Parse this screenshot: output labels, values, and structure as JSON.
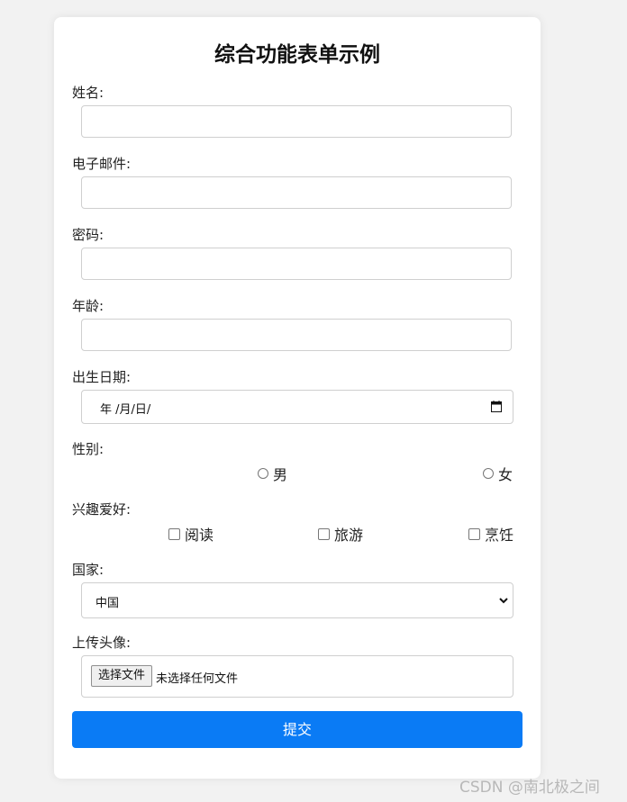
{
  "form": {
    "title": "综合功能表单示例",
    "name_label": "姓名:",
    "email_label": "电子邮件:",
    "password_label": "密码:",
    "age_label": "年龄:",
    "birthdate_label": "出生日期:",
    "birthdate_placeholder": "年 /月/日/",
    "gender_label": "性别:",
    "gender_options": [
      "男",
      "女"
    ],
    "hobbies_label": "兴趣爱好:",
    "hobby_options": [
      "阅读",
      "旅游",
      "烹饪"
    ],
    "country_label": "国家:",
    "country_selected": "中国",
    "avatar_label": "上传头像:",
    "file_button": "选择文件",
    "file_status": "未选择任何文件",
    "submit_label": "提交"
  },
  "watermark": "CSDN @南北极之间",
  "colors": {
    "accent": "#0a7bf5",
    "background": "#f2f2f2",
    "card": "#ffffff",
    "border": "#cfcfcf"
  },
  "icons": {
    "date_picker": "calendar-icon",
    "select_arrow": "chevron-down-icon"
  }
}
